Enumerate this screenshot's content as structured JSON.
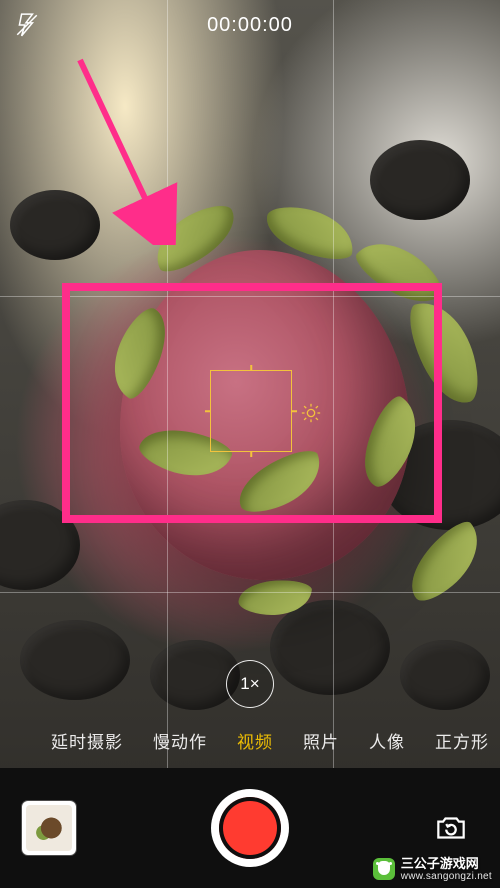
{
  "top": {
    "timer": "00:00:00",
    "flash_icon_name": "flash-off-icon"
  },
  "zoom": {
    "label": "1×"
  },
  "modes": {
    "items": [
      {
        "label": "延时摄影",
        "id": "mode-timelapse",
        "active": false
      },
      {
        "label": "慢动作",
        "id": "mode-slomo",
        "active": false
      },
      {
        "label": "视频",
        "id": "mode-video",
        "active": true
      },
      {
        "label": "照片",
        "id": "mode-photo",
        "active": false
      },
      {
        "label": "人像",
        "id": "mode-portrait",
        "active": false
      },
      {
        "label": "正方形",
        "id": "mode-square",
        "active": false
      }
    ]
  },
  "focus": {
    "color": "#f3c33c"
  },
  "annotation": {
    "highlight_color": "#ff2d8a"
  },
  "watermark": {
    "title": "三公子游戏网",
    "url": "www.sangongzi.net"
  },
  "icons": {
    "flip": "camera-flip-icon",
    "shutter": "record-button",
    "thumbnail": "last-photo-thumbnail"
  }
}
